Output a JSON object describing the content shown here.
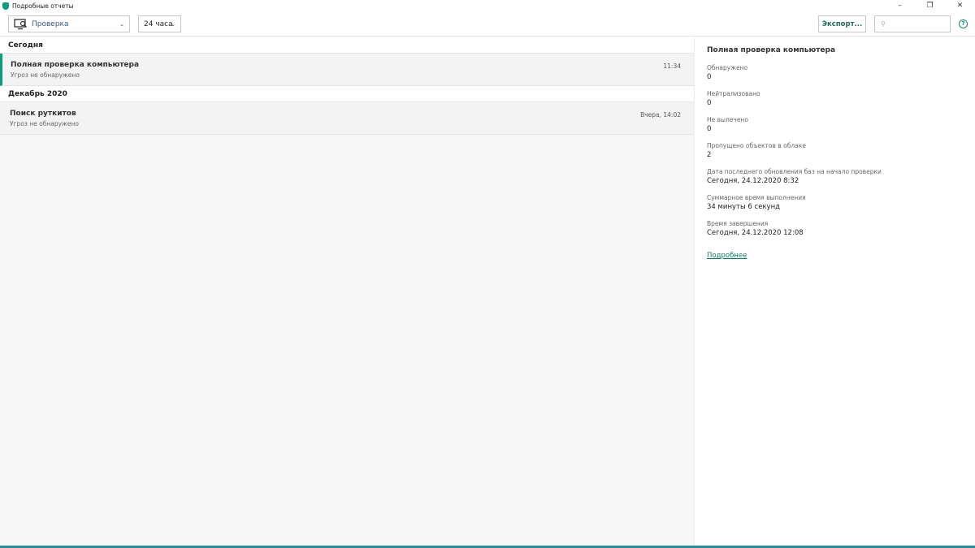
{
  "window": {
    "title": "Подробные отчеты",
    "minimize": "–",
    "restore": "❐",
    "close": "✕"
  },
  "toolbar": {
    "type_filter": "Проверка",
    "period_filter": "24 часа",
    "export_label": "Экспорт...",
    "search_placeholder": "",
    "help": "?"
  },
  "groups": [
    {
      "label": "Сегодня",
      "items": [
        {
          "title": "Полная проверка компьютера",
          "subtitle": "Угроз не обнаружено",
          "time": "11:34"
        }
      ]
    },
    {
      "label": "Декабрь 2020",
      "items": [
        {
          "title": "Поиск руткитов",
          "subtitle": "Угроз не обнаружено",
          "time": "Вчера, 14:02"
        }
      ]
    }
  ],
  "details": {
    "title": "Полная проверка компьютера",
    "fields": [
      {
        "label": "Обнаружено",
        "value": "0"
      },
      {
        "label": "Нейтрализовано",
        "value": "0"
      },
      {
        "label": "Не вылечено",
        "value": "0"
      },
      {
        "label": "Пропущено объектов в облаке",
        "value": "2"
      },
      {
        "label": "Дата последнего обновления баз на начало проверки",
        "value": "Сегодня, 24.12.2020 8:32"
      },
      {
        "label": "Суммарное время выполнения",
        "value": "34 минуты 6 секунд"
      },
      {
        "label": "Время завершения",
        "value": "Сегодня, 24.12.2020 12:08"
      }
    ],
    "more_link": "Подробнее"
  }
}
